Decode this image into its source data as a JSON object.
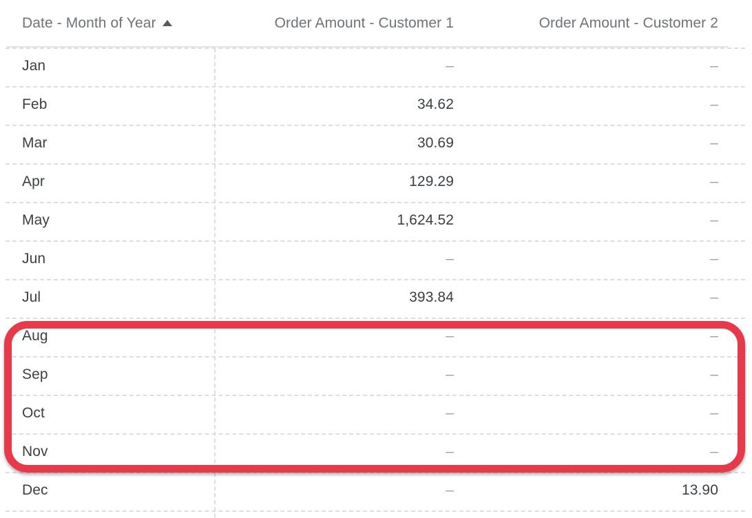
{
  "table": {
    "columns": [
      {
        "id": "date",
        "label": "Date - Month of Year",
        "align": "left",
        "sort": "ascending",
        "sort_icon": "sort-ascending-triangle-icon"
      },
      {
        "id": "cust1",
        "label": "Order Amount - Customer 1",
        "align": "right",
        "sort": "none"
      },
      {
        "id": "cust2",
        "label": "Order Amount - Customer 2",
        "align": "right",
        "sort": "none"
      }
    ],
    "null_placeholder": "–",
    "rows": [
      {
        "date": "Jan",
        "cust1": "–",
        "cust2": "–"
      },
      {
        "date": "Feb",
        "cust1": "34.62",
        "cust2": "–"
      },
      {
        "date": "Mar",
        "cust1": "30.69",
        "cust2": "–"
      },
      {
        "date": "Apr",
        "cust1": "129.29",
        "cust2": "–"
      },
      {
        "date": "May",
        "cust1": "1,624.52",
        "cust2": "–"
      },
      {
        "date": "Jun",
        "cust1": "–",
        "cust2": "–"
      },
      {
        "date": "Jul",
        "cust1": "393.84",
        "cust2": "–"
      },
      {
        "date": "Aug",
        "cust1": "–",
        "cust2": "–"
      },
      {
        "date": "Sep",
        "cust1": "–",
        "cust2": "–"
      },
      {
        "date": "Oct",
        "cust1": "–",
        "cust2": "–"
      },
      {
        "date": "Nov",
        "cust1": "–",
        "cust2": "–"
      },
      {
        "date": "Dec",
        "cust1": "–",
        "cust2": "13.90"
      }
    ]
  },
  "annotation": {
    "shape": "rounded-rectangle-outline",
    "color": "#e8394b",
    "covers_rows": [
      "Aug",
      "Sep",
      "Oct",
      "Nov"
    ]
  },
  "colors": {
    "header_text": "#6e7378",
    "body_text": "#3c4043",
    "null_text": "#9aa2ab",
    "grid_line": "#dcdfe2",
    "header_rule": "#e2e4e6",
    "annotation_red": "#e8394b",
    "background": "#ffffff"
  }
}
